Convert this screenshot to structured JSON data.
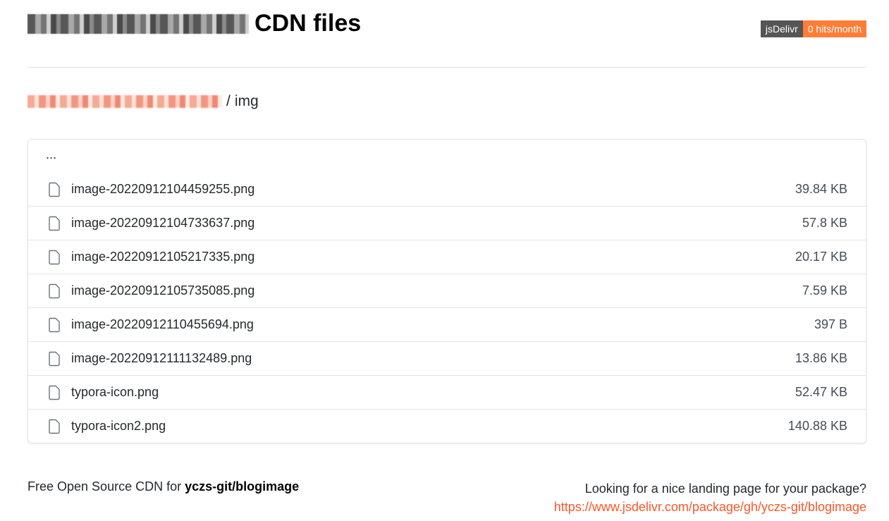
{
  "header": {
    "title_suffix": "CDN files",
    "badge_left": "jsDelivr",
    "badge_right": "0 hits/month",
    "badge_left_color": "#555555",
    "badge_right_color": "#fe7d37"
  },
  "breadcrumb": {
    "separator": "/",
    "current": "img"
  },
  "files": {
    "parent_label": "...",
    "items": [
      {
        "name": "image-20220912104459255.png",
        "size": "39.84 KB",
        "icon": "file-icon"
      },
      {
        "name": "image-20220912104733637.png",
        "size": "57.8 KB",
        "icon": "file-icon"
      },
      {
        "name": "image-20220912105217335.png",
        "size": "20.17 KB",
        "icon": "file-icon"
      },
      {
        "name": "image-20220912105735085.png",
        "size": "7.59 KB",
        "icon": "file-icon"
      },
      {
        "name": "image-20220912110455694.png",
        "size": "397 B",
        "icon": "file-icon"
      },
      {
        "name": "image-20220912111132489.png",
        "size": "13.86 KB",
        "icon": "file-icon"
      },
      {
        "name": "typora-icon.png",
        "size": "52.47 KB",
        "icon": "file-icon"
      },
      {
        "name": "typora-icon2.png",
        "size": "140.88 KB",
        "icon": "file-icon"
      }
    ]
  },
  "footer": {
    "left_prefix": "Free Open Source CDN for ",
    "left_package": "yczs-git/blogimage",
    "right_question": "Looking for a nice landing page for your package?",
    "right_link": "https://www.jsdelivr.com/package/gh/yczs-git/blogimage",
    "link_color": "#ff5627"
  }
}
